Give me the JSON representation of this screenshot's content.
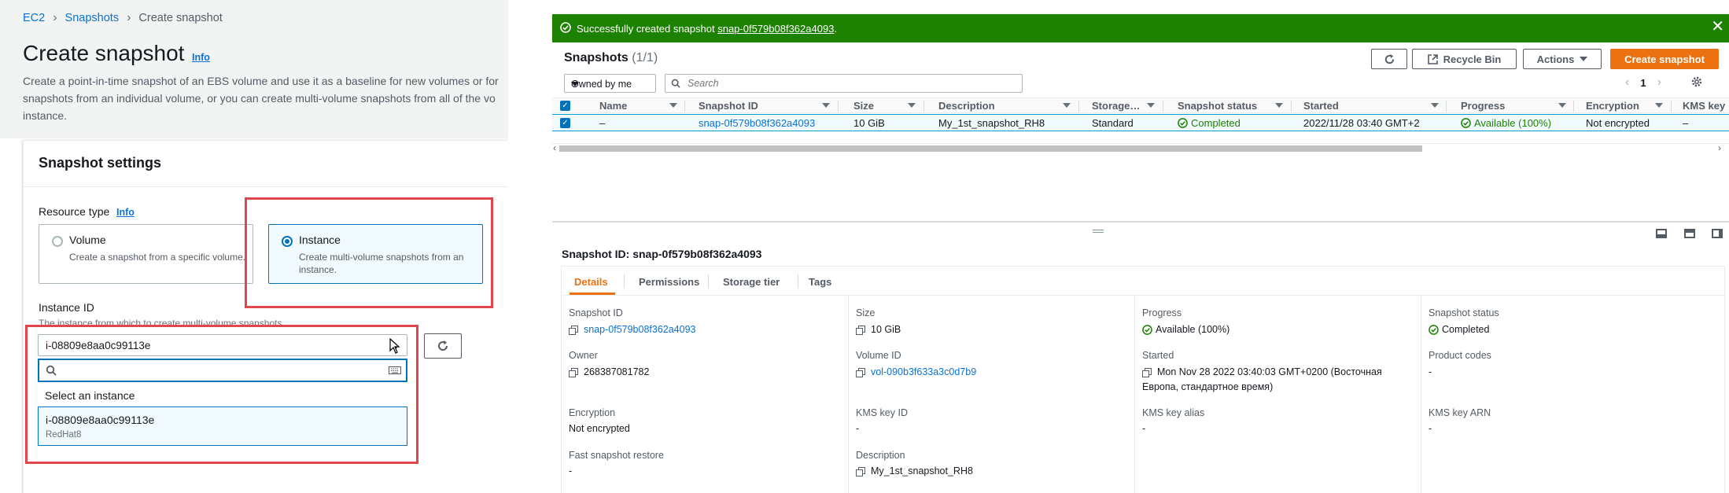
{
  "left": {
    "breadcrumb": {
      "ec2": "EC2",
      "snapshots": "Snapshots",
      "current": "Create snapshot"
    },
    "title": "Create snapshot",
    "title_info": "Info",
    "description_line1": "Create a point-in-time snapshot of an EBS volume and use it as a baseline for new volumes or for",
    "description_line2": "snapshots from an individual volume, or you can create multi-volume snapshots from all of the vo",
    "description_line3": "instance.",
    "settings_title": "Snapshot settings",
    "resource_type_label": "Resource type",
    "resource_type_info": "Info",
    "volume_title": "Volume",
    "volume_desc": "Create a snapshot from a specific volume.",
    "instance_title": "Instance",
    "instance_desc": "Create multi-volume snapshots from an instance.",
    "instance_id_label": "Instance ID",
    "instance_id_desc": "The instance from which to create multi-volume snapshots.",
    "instance_id_value": "i-08809e8aa0c99113e",
    "search_placeholder": "",
    "dropdown_header": "Select an instance",
    "option_id": "i-08809e8aa0c99113e",
    "option_name": "RedHat8"
  },
  "flash": {
    "prefix": "Successfully created snapshot ",
    "link": "snap-0f579b08f362a4093",
    "suffix": "."
  },
  "snapshots": {
    "heading": "Snapshots",
    "count": "(1/1)",
    "buttons": {
      "recycle_bin": "Recycle Bin",
      "actions": "Actions",
      "create": "Create snapshot"
    },
    "filter_owner": "Owned by me",
    "search_placeholder": "Search",
    "page": "1",
    "columns": [
      "Name",
      "Snapshot ID",
      "Size",
      "Description",
      "Storage…",
      "Snapshot status",
      "Started",
      "Progress",
      "Encryption",
      "KMS key"
    ],
    "row": {
      "name": "–",
      "snapshot_id": "snap-0f579b08f362a4093",
      "size": "10 GiB",
      "description": "My_1st_snapshot_RH8",
      "storage": "Standard",
      "status": "Completed",
      "started": "2022/11/28 03:40 GMT+2",
      "progress": "Available (100%)",
      "encryption": "Not encrypted",
      "kms": "–"
    }
  },
  "details": {
    "title": "Snapshot ID: snap-0f579b08f362a4093",
    "tabs": [
      "Details",
      "Permissions",
      "Storage tier",
      "Tags"
    ],
    "fields": {
      "snapshot_id_label": "Snapshot ID",
      "snapshot_id": "snap-0f579b08f362a4093",
      "size_label": "Size",
      "size": "10 GiB",
      "progress_label": "Progress",
      "progress": "Available (100%)",
      "status_label": "Snapshot status",
      "status": "Completed",
      "owner_label": "Owner",
      "owner": "268387081782",
      "volume_id_label": "Volume ID",
      "volume_id": "vol-090b3f633a3c0d7b9",
      "started_label": "Started",
      "started_line1": "Mon Nov 28 2022 03:40:03 GMT+0200 (Восточная",
      "started_line2": "Европа, стандартное время)",
      "product_codes_label": "Product codes",
      "product_codes": "-",
      "encryption_label": "Encryption",
      "encryption": "Not encrypted",
      "kms_key_id_label": "KMS key ID",
      "kms_key_id": "-",
      "kms_alias_label": "KMS key alias",
      "kms_alias": "-",
      "kms_arn_label": "KMS key ARN",
      "kms_arn": "-",
      "fast_restore_label": "Fast snapshot restore",
      "fast_restore": "-",
      "description_label": "Description",
      "description": "My_1st_snapshot_RH8"
    }
  },
  "colors": {
    "accent": "#0972d3",
    "success": "#1d8102",
    "primary": "#ec7211",
    "highlight": "#e0464b"
  },
  "icons": [
    "check-circle-icon",
    "close-icon",
    "refresh-icon",
    "external-link-icon",
    "search-icon",
    "gear-icon",
    "copy-icon",
    "keyboard-icon",
    "mouse-cursor-icon",
    "sort-icon",
    "chevron-left-icon",
    "chevron-right-icon"
  ]
}
